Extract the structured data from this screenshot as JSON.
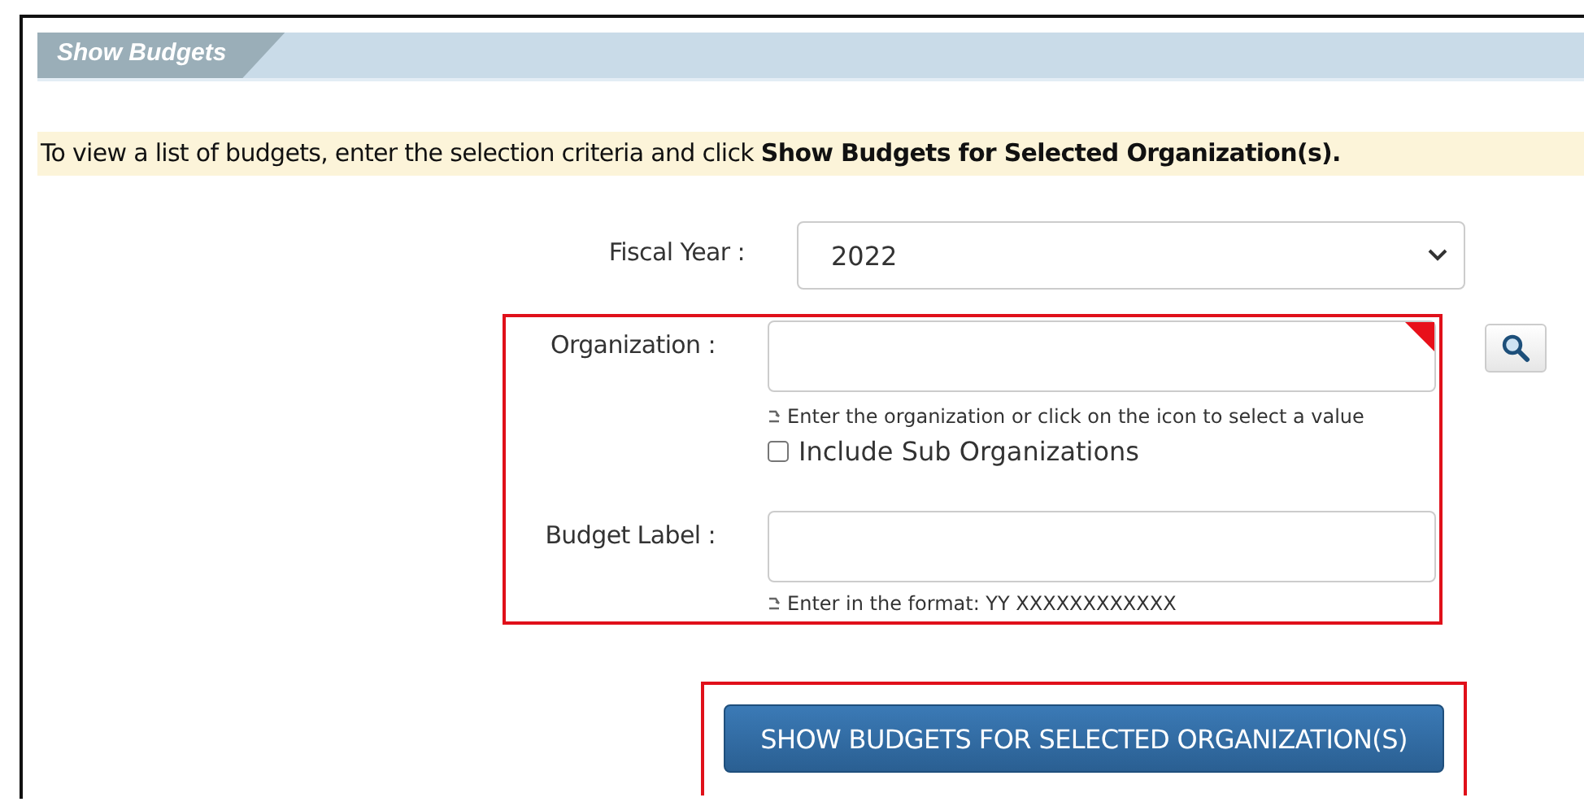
{
  "panel": {
    "title": "Show Budgets"
  },
  "instruction": "To view a list of budgets, enter the selection criteria and click **Show Budgets for Selected Organization(s).**",
  "fiscal_year": {
    "label": "Fiscal Year :",
    "value": "2022"
  },
  "organization": {
    "label": "Organization :",
    "required": true,
    "hint": "Enter the organization or click on the icon to select a value"
  },
  "include_sub": {
    "label": "Include Sub Organizations",
    "checked": false
  },
  "budget_label": {
    "label": "Budget Label :",
    "hint": "Enter in the format: YY XXXXXXXXXXXX"
  },
  "submit_button": "SHOW BUDGETS FOR SELECTED ORGANIZATION(S)"
}
